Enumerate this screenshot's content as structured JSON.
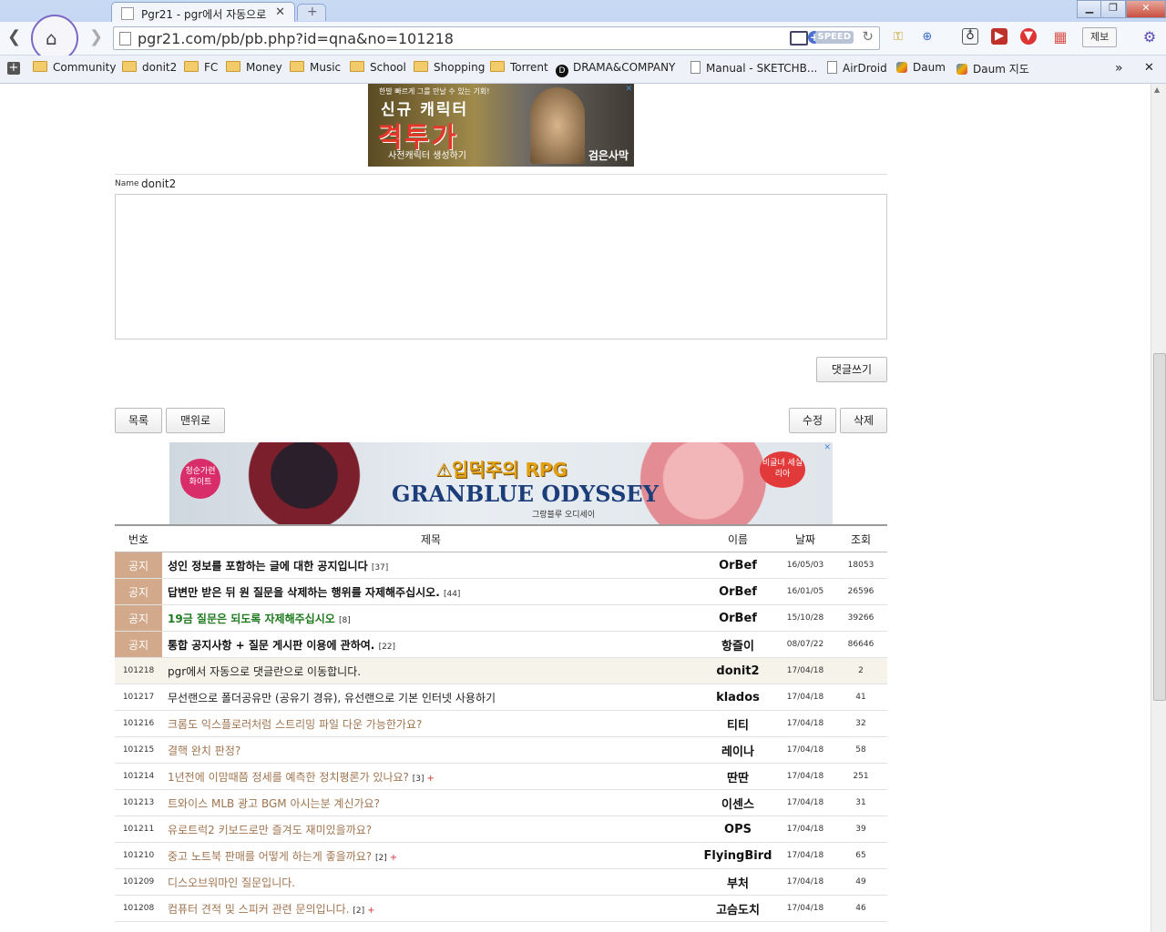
{
  "browser": {
    "tab_title": "Pgr21 - pgr에서 자동으로",
    "new_tab": "+",
    "url": "pgr21.com/pb/pb.php?id=qna&no=101218",
    "speed_badge": "SPEED",
    "report_label": "제보"
  },
  "bookmarks": [
    {
      "label": "Community",
      "type": "folder"
    },
    {
      "label": "donit2",
      "type": "folder"
    },
    {
      "label": "FC",
      "type": "folder"
    },
    {
      "label": "Money",
      "type": "folder"
    },
    {
      "label": "Music",
      "type": "folder"
    },
    {
      "label": "School",
      "type": "folder"
    },
    {
      "label": "Shopping",
      "type": "folder"
    },
    {
      "label": "Torrent",
      "type": "folder"
    },
    {
      "label": "DRAMA&COMPANY",
      "type": "site"
    },
    {
      "label": "Manual - SKETCHB...",
      "type": "page"
    },
    {
      "label": "AirDroid",
      "type": "page"
    },
    {
      "label": "Daum",
      "type": "daum"
    },
    {
      "label": "Daum 지도",
      "type": "daum"
    }
  ],
  "ads": {
    "top": {
      "small": "한발 빠르게 그를 만날 수 있는 기회!",
      "line1": "신규 캐릭터",
      "line2": "격투가",
      "line3": "사전캐릭터 생성하기",
      "brand": "검은사막"
    },
    "mid": {
      "badge_left": "청순가련 화이트",
      "badge_right": "비글녀 세실리아",
      "warning": "⚠입덕주의 RPG",
      "logo": "GRANBLUE ODYSSEY",
      "sub": "그랑블루 오디세이"
    }
  },
  "comment": {
    "name_label": "Name",
    "name_value": "donit2",
    "submit_label": "댓글쓰기"
  },
  "actions": {
    "list": "목록",
    "top": "맨위로",
    "edit": "수정",
    "delete": "삭제"
  },
  "board": {
    "headers": {
      "num": "번호",
      "subject": "제목",
      "author": "이름",
      "date": "날짜",
      "hits": "조회"
    },
    "notice_tag": "공지",
    "notices": [
      {
        "subject": "성인 정보를 포함하는 글에 대한 공지입니다",
        "comments": "[37]",
        "author": "OrBef",
        "date": "16/05/03",
        "hits": "18053",
        "color": "#111111"
      },
      {
        "subject": "답변만 받은 뒤 원 질문을 삭제하는 행위를 자제해주십시오.",
        "comments": "[44]",
        "author": "OrBef",
        "date": "16/01/05",
        "hits": "26596",
        "color": "#111111"
      },
      {
        "subject": "19금 질문은 되도록 자제해주십시오",
        "comments": "[8]",
        "author": "OrBef",
        "date": "15/10/28",
        "hits": "39266",
        "color": "#1e7a1e"
      },
      {
        "subject": "통합 공지사항 + 질문 게시판 이용에 관하여.",
        "comments": "[22]",
        "author": "항즐이",
        "date": "08/07/22",
        "hits": "86646",
        "color": "#111111"
      }
    ],
    "rows": [
      {
        "num": "101218",
        "subject": "pgr에서 자동으로 댓글란으로 이동합니다.",
        "comments": "",
        "plus": "",
        "author": "donit2",
        "date": "17/04/18",
        "hits": "2",
        "color": "#222222",
        "current": true
      },
      {
        "num": "101217",
        "subject": "무선랜으로 폴더공유만 (공유기 경유), 유선랜으로 기본 인터넷 사용하기",
        "comments": "",
        "plus": "",
        "author": "klados",
        "date": "17/04/18",
        "hits": "41",
        "color": "#222222",
        "current": false
      },
      {
        "num": "101216",
        "subject": "크롬도 익스플로러처럼 스트리밍 파일 다운 가능한가요?",
        "comments": "",
        "plus": "",
        "author": "티티",
        "date": "17/04/18",
        "hits": "32",
        "color": "#a0744f",
        "current": false
      },
      {
        "num": "101215",
        "subject": "결핵 완치 판정?",
        "comments": "",
        "plus": "",
        "author": "레이나",
        "date": "17/04/18",
        "hits": "58",
        "color": "#a0744f",
        "current": false
      },
      {
        "num": "101214",
        "subject": "1년전에 이맘때쯤 정세를 예측한 정치평론가 있나요?",
        "comments": "[3]",
        "plus": "+",
        "author": "딴딴",
        "date": "17/04/18",
        "hits": "251",
        "color": "#a0744f",
        "current": false
      },
      {
        "num": "101213",
        "subject": "트와이스 MLB 광고 BGM 아시는분 계신가요?",
        "comments": "",
        "plus": "",
        "author": "이센스",
        "date": "17/04/18",
        "hits": "31",
        "color": "#a0744f",
        "current": false
      },
      {
        "num": "101211",
        "subject": "유로트럭2 키보드로만 즐겨도 재미있을까요?",
        "comments": "",
        "plus": "",
        "author": "OPS",
        "date": "17/04/18",
        "hits": "39",
        "color": "#a0744f",
        "current": false
      },
      {
        "num": "101210",
        "subject": "중고 노트북 판매를 어떻게 하는게 좋을까요?",
        "comments": "[2]",
        "plus": "+",
        "author": "FlyingBird",
        "date": "17/04/18",
        "hits": "65",
        "color": "#a0744f",
        "current": false
      },
      {
        "num": "101209",
        "subject": "디스오브워마인 질문입니다.",
        "comments": "",
        "plus": "",
        "author": "부처",
        "date": "17/04/18",
        "hits": "49",
        "color": "#a0744f",
        "current": false
      },
      {
        "num": "101208",
        "subject": "컴퓨터 견적 및 스피커 관련 문의입니다.",
        "comments": "[2]",
        "plus": "+",
        "author": "고슴도치",
        "date": "17/04/18",
        "hits": "46",
        "color": "#a0744f",
        "current": false
      }
    ]
  }
}
